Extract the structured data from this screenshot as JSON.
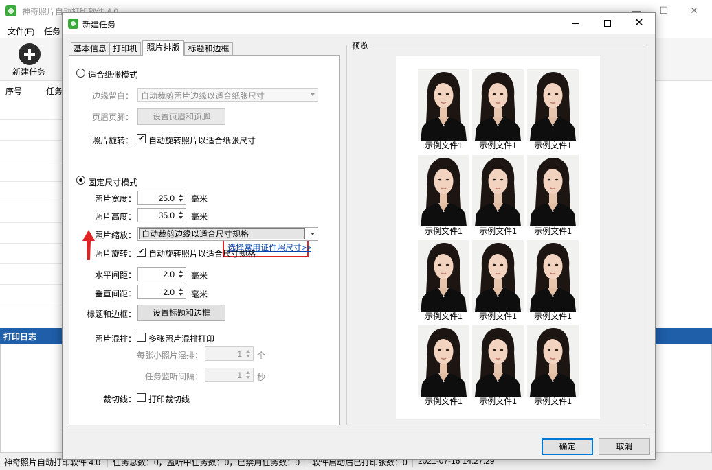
{
  "main_window": {
    "title": "神奇照片自动打印软件 4.0",
    "controls": {
      "minimize": "—",
      "maximize": "☐",
      "close": "✕"
    },
    "menu": [
      "文件(F)",
      "任务"
    ],
    "toolbar": {
      "new_task": "新建任务",
      "new_task_icon": "plus-circle-icon"
    },
    "task_columns": [
      "序号",
      "任务"
    ],
    "log_title": "打印日志",
    "status": [
      "神奇照片自动打印软件 4.0",
      "任务总数：0，监听中任务数：0，已禁用任务数：0",
      "软件启动后已打印张数：0",
      "2021-07-16 14:27:29"
    ]
  },
  "dialog": {
    "title": "新建任务",
    "tabs": [
      "基本信息",
      "打印机",
      "照片排版",
      "标题和边框"
    ],
    "active_tab": 2,
    "fit_paper": {
      "label": "适合纸张模式",
      "margin_label": "边缘留白：",
      "margin_value": "自动裁剪照片边缘以适合纸张尺寸",
      "header_footer_label": "页眉页脚：",
      "header_footer_button": "设置页眉和页脚",
      "rotate_label": "照片旋转：",
      "rotate_check": "自动旋转照片以适合纸张尺寸"
    },
    "fixed_size": {
      "label": "固定尺寸模式",
      "width_label": "照片宽度：",
      "width_value": "25.0",
      "height_label": "照片高度：",
      "height_value": "35.0",
      "unit": "毫米",
      "preset_link": "选择常用证件照尺寸>>",
      "scale_label": "照片缩放：",
      "scale_value": "自动裁剪边缘以适合尺寸规格",
      "rotate_label": "照片旋转：",
      "rotate_check": "自动旋转照片以适合尺寸规格",
      "h_gap_label": "水平间距：",
      "h_gap_value": "2.0",
      "v_gap_label": "垂直间距：",
      "v_gap_value": "2.0",
      "title_border_label": "标题和边框：",
      "title_border_button": "设置标题和边框"
    },
    "mix": {
      "label": "照片混排：",
      "check": "多张照片混排打印",
      "per_sheet_label": "每张小照片混排：",
      "per_sheet_value": "1",
      "per_sheet_unit": "个",
      "interval_label": "任务监听间隔：",
      "interval_value": "1",
      "interval_unit": "秒"
    },
    "cut_line": {
      "label": "裁切线：",
      "check": "打印裁切线"
    },
    "preview": {
      "legend": "预览",
      "caption": "示例文件1",
      "rows": 4,
      "cols": 3
    },
    "buttons": {
      "ok": "确定",
      "cancel": "取消"
    },
    "colors": {
      "accent": "#0078d7",
      "highlight_box": "#e02424",
      "arrow": "#e02424",
      "log_bar": "#1f5ea8"
    }
  }
}
